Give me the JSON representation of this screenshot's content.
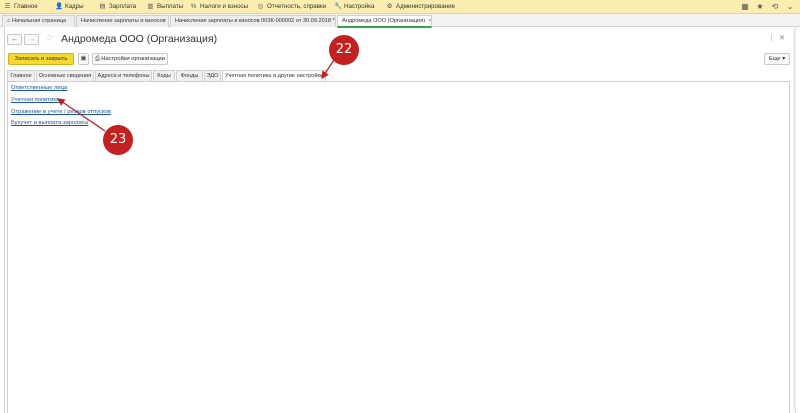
{
  "menu": {
    "items": [
      {
        "icon": "☰",
        "label": "Главное"
      },
      {
        "icon": "👤",
        "label": "Кадры"
      },
      {
        "icon": "▤",
        "label": "Зарплата"
      },
      {
        "icon": "▥",
        "label": "Выплаты"
      },
      {
        "icon": "%",
        "label": "Налоги и взносы"
      },
      {
        "icon": "◎",
        "label": "Отчетность, справки"
      },
      {
        "icon": "🔧",
        "label": "Настройка"
      },
      {
        "icon": "⚙",
        "label": "Администрирование"
      }
    ],
    "right_icons": [
      "grid-icon",
      "star-icon",
      "history-icon",
      "chevron-down-icon"
    ]
  },
  "window_tabs": [
    {
      "label": "Начальная страница",
      "closable": false
    },
    {
      "label": "Начисление зарплаты и взносов",
      "closable": true
    },
    {
      "label": "Начисление зарплаты и взносов 003К-000002 от 30.09.2018 *",
      "closable": true
    },
    {
      "label": "Андромеда ООО (Организация)",
      "closable": true,
      "active": true
    }
  ],
  "header": {
    "title": "Андромеда ООО (Организация)"
  },
  "toolbar": {
    "save_close": "Записать и закрыть",
    "settings": "Настройки организации",
    "more": "Еще"
  },
  "form_tabs": [
    {
      "label": "Главное"
    },
    {
      "label": "Основные сведения"
    },
    {
      "label": "Адреса и телефоны"
    },
    {
      "label": "Коды"
    },
    {
      "label": "Фонды"
    },
    {
      "label": "ЭДО"
    },
    {
      "label": "Учетная политика и другие настройки",
      "active": true
    }
  ],
  "links": [
    "Ответственные лица",
    "Учетная политика",
    "Отражение в учете / резерв отпусков",
    "Бухучет и выплата зарплаты"
  ],
  "annotations": [
    "22",
    "23"
  ],
  "colors": {
    "menu_bg": "#fbedb0",
    "primary_button": "#f6d930",
    "link": "#1a56a8",
    "badge": "#c42020",
    "active_tab_accent": "#35a353"
  }
}
